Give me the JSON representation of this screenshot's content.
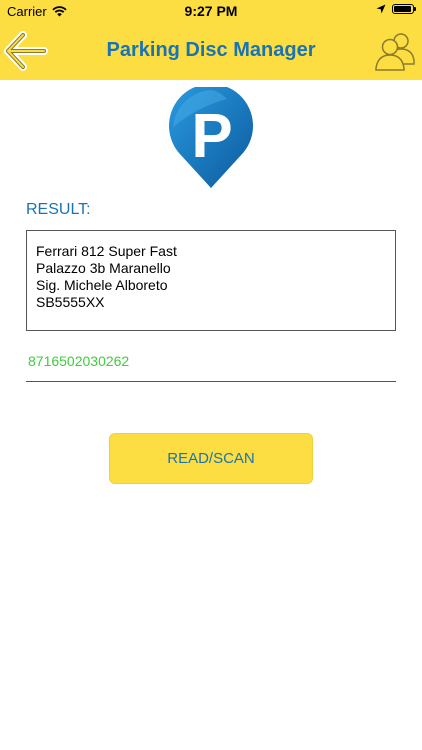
{
  "status_bar": {
    "carrier": "Carrier",
    "time": "9:27 PM"
  },
  "nav_bar": {
    "title": "Parking Disc Manager",
    "back_icon": "back-arrow-icon",
    "users_icon": "users-icon"
  },
  "logo": {
    "icon": "parking-pin-icon",
    "letter": "P"
  },
  "result": {
    "label": "RESULT:",
    "lines": [
      "Ferrari 812 Super Fast",
      "Palazzo 3b Maranello",
      "Sig. Michele Alboreto",
      "SB5555XX"
    ]
  },
  "barcode": {
    "value": "8716502030262"
  },
  "scan_button": {
    "label": "READ/SCAN"
  },
  "colors": {
    "header_bg": "#fcde42",
    "accent_blue": "#1a73b3",
    "barcode_green": "#3fcc3f"
  }
}
